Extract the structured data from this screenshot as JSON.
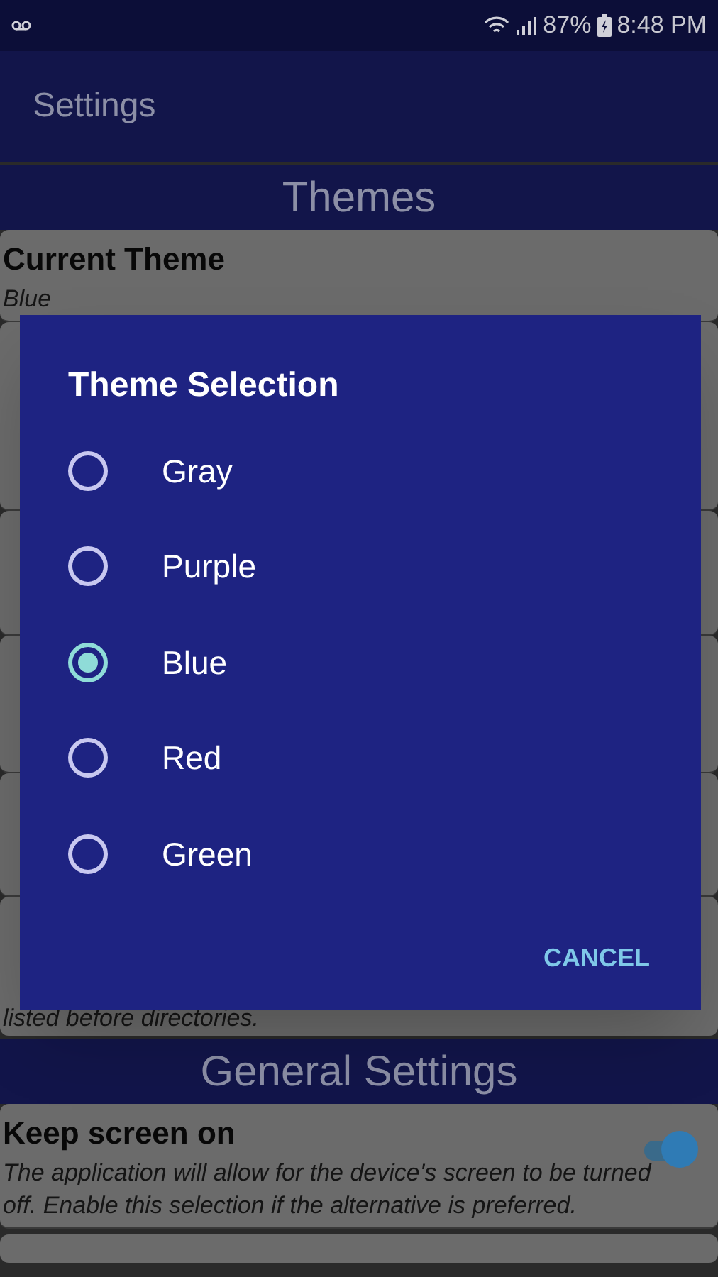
{
  "status_bar": {
    "battery": "87%",
    "time": "8:48 PM"
  },
  "app_bar": {
    "title": "Settings"
  },
  "sections": [
    {
      "kind": "header",
      "title": "Themes"
    },
    {
      "kind": "item",
      "title": "Current Theme",
      "summary": "Blue"
    },
    {
      "kind": "hidden"
    },
    {
      "kind": "hidden"
    },
    {
      "kind": "hidden"
    },
    {
      "kind": "hidden"
    },
    {
      "kind": "tail",
      "summary": "listed before directories."
    },
    {
      "kind": "header",
      "title": "General Settings"
    },
    {
      "kind": "switch",
      "title": "Keep screen on",
      "summary": "The application will allow for the device's screen to be turned off. Enable this selection if the alternative is preferred.",
      "on": true
    },
    {
      "kind": "cut"
    }
  ],
  "dialog": {
    "title": "Theme Selection",
    "options": [
      {
        "label": "Gray",
        "selected": false
      },
      {
        "label": "Purple",
        "selected": false
      },
      {
        "label": "Blue",
        "selected": true
      },
      {
        "label": "Red",
        "selected": false
      },
      {
        "label": "Green",
        "selected": false
      }
    ],
    "button": "CANCEL"
  }
}
